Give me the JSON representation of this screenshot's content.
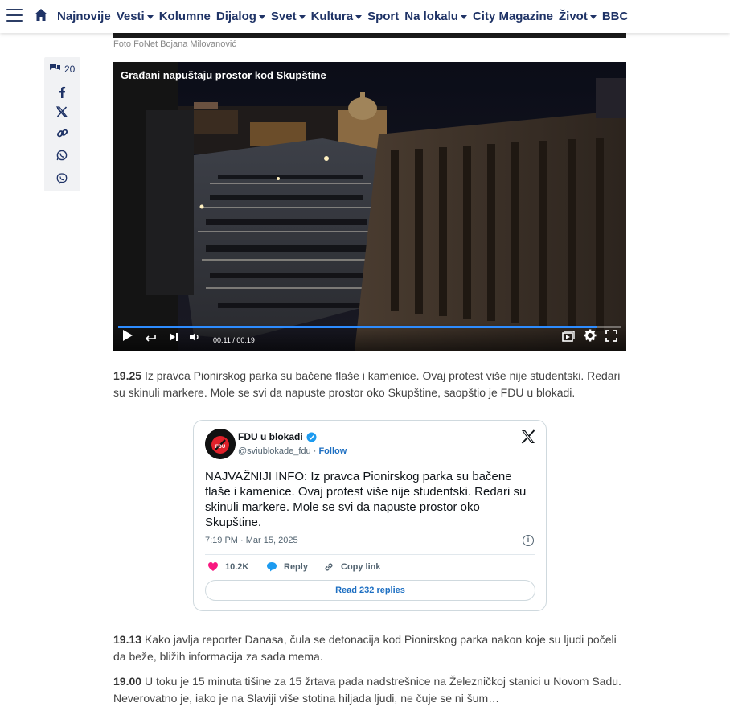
{
  "nav": {
    "items": [
      {
        "label": "Najnovije",
        "dropdown": false
      },
      {
        "label": "Vesti",
        "dropdown": true
      },
      {
        "label": "Kolumne",
        "dropdown": false
      },
      {
        "label": "Dijalog",
        "dropdown": true
      },
      {
        "label": "Svet",
        "dropdown": true
      },
      {
        "label": "Kultura",
        "dropdown": true
      },
      {
        "label": "Sport",
        "dropdown": false
      },
      {
        "label": "Na lokalu",
        "dropdown": true
      },
      {
        "label": "City Magazine",
        "dropdown": false
      },
      {
        "label": "Život",
        "dropdown": true
      },
      {
        "label": "BBC",
        "dropdown": false
      }
    ],
    "accent_color": "#1f3366"
  },
  "photo": {
    "caption": "Foto FoNet Bojana Milovanović"
  },
  "share": {
    "comment_count": "20",
    "icons": [
      "facebook-icon",
      "x-icon",
      "link-icon",
      "whatsapp-icon",
      "viber-icon"
    ]
  },
  "video": {
    "title": "Građani napuštaju prostor kod Skupštine",
    "time": "00:11 / 00:19",
    "progress": 0.95
  },
  "entries": {
    "e1": {
      "time": "19.25",
      "text": "Iz pravca Pionirskog parka su bačene flaše i kamenice. Ovaj protest više nije studentski. Redari su skinuli markere. Mole se svi da napuste prostor oko Skupštine, saopštio je FDU u blokadi."
    },
    "e2": {
      "time": "19.13",
      "text": "Kako javlja reporter Danasa, čula se detonacija kod Pionirskog parka nakon koje su ljudi počeli da beže, bližih informacija za sada mema."
    },
    "e3": {
      "time": "19.00",
      "text": "U toku je 15 minuta tišine za 15 žrtava pada nadstrešnice na Železničkoj stanici u Novom Sadu. Neverovatno je, iako je na Slaviji više stotina hiljada ljudi, ne čuje se ni šum…"
    }
  },
  "tweet": {
    "name": "FDU u blokadi",
    "handle": "@sviublokade_fdu",
    "separator": " · ",
    "follow": "Follow",
    "avatar_text": "FDU",
    "text": "NAJVAŽNIJI INFO: Iz pravca Pionirskog parka su bačene flaše i kamenice. Ovaj protest više nije studentski. Redari su skinuli markere. Mole se svi da napuste prostor oko Skupštine.",
    "date": "7:19 PM · Mar 15, 2025",
    "likes": "10.2K",
    "reply": "Reply",
    "copy_link": "Copy link",
    "read_replies": "Read 232 replies"
  }
}
